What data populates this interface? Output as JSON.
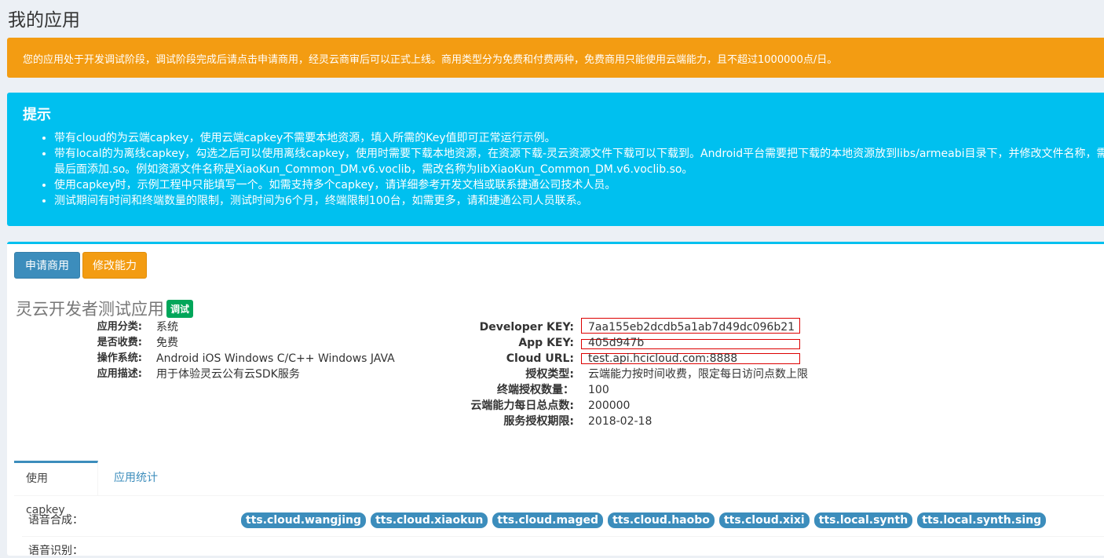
{
  "page_title": "我的应用",
  "warning_text": "您的应用处于开发调试阶段，调试阶段完成后请点击申请商用，经灵云商审后可以正式上线。商用类型分为免费和付费两种，免费商用只能使用云端能力，且不超过1000000点/日。",
  "callout": {
    "title": "提示",
    "items": [
      "带有cloud的为云端capkey，使用云端capkey不需要本地资源，填入所需的Key值即可正常运行示例。",
      "带有local的为离线capkey，勾选之后可以使用离线capkey，使用时需要下载本地资源，在资源下载-灵云资源文件下载可以下载到。Android平台需要把下载的本地资源放到libs/armeabi目录下，并修改文件名称，需要在最后面添加.so。例如资源文件名称是XiaoKun_Common_DM.v6.voclib，需改名称为libXiaoKun_Common_DM.v6.voclib.so。",
      "使用capkey时，示例工程中只能填写一个。如需支持多个capkey，请详细参考开发文档或联系捷通公司技术人员。",
      "测试期间有时间和终端数量的限制，测试时间为6个月，终端限制100台，如需更多，请和捷通公司人员联系。"
    ]
  },
  "buttons": {
    "apply_commercial": "申请商用",
    "modify_ability": "修改能力"
  },
  "app": {
    "name": "灵云开发者测试应用",
    "badge": "调试",
    "left_info": [
      {
        "label": "应用分类:",
        "value": "系统"
      },
      {
        "label": "是否收费:",
        "value": "免费"
      },
      {
        "label": "操作系统:",
        "value": "Android iOS Windows C/C++ Windows JAVA"
      },
      {
        "label": "应用描述:",
        "value": "用于体验灵云公有云SDK服务"
      }
    ],
    "right_info": [
      {
        "label": "Developer KEY:",
        "value": "7aa155eb2dcdb5a1ab7d49dc096b21"
      },
      {
        "label": "App KEY:",
        "value": "405d947b"
      },
      {
        "label": "Cloud URL:",
        "value": "test.api.hcicloud.com:8888"
      },
      {
        "label": "授权类型:",
        "value": "云端能力按时间收费，限定每日访问点数上限"
      },
      {
        "label": "终端授权数量：",
        "value": "100"
      },
      {
        "label": "云端能力每日总点数:",
        "value": "200000"
      },
      {
        "label": "服务授权期限:",
        "value": "2018-02-18"
      }
    ]
  },
  "tabs": [
    {
      "label": "使用capkey"
    },
    {
      "label": "应用统计"
    }
  ],
  "capkeys": {
    "tts_label": "语音合成：",
    "tts": [
      "tts.cloud.wangjing",
      "tts.cloud.xiaokun",
      "tts.cloud.maged",
      "tts.cloud.haobo",
      "tts.cloud.xixi",
      "tts.local.synth",
      "tts.local.synth.sing"
    ],
    "asr_label": "语音识别："
  },
  "colors": {
    "warning": "#f39c12",
    "info": "#00c0ef",
    "primary": "#3c8dbc",
    "success": "#00a65a"
  }
}
